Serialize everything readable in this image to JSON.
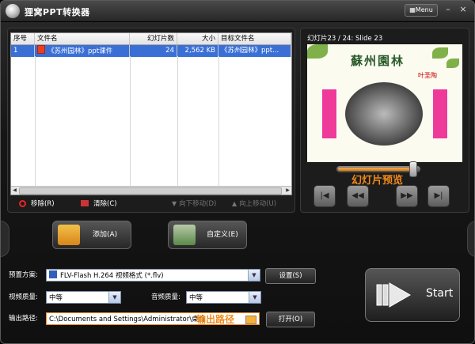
{
  "app": {
    "title": "狸窝PPT转换器",
    "menu_label": "Menu",
    "minimize": "–",
    "close": "×"
  },
  "filelist": {
    "columns": [
      "序号",
      "文件名",
      "幻灯片数",
      "大小",
      "目标文件名"
    ],
    "rows": [
      {
        "index": "1",
        "name": "《苏州园林》ppt课件",
        "slides": "24",
        "size": "2,562 KB",
        "target": "《苏州园林》ppt..."
      }
    ]
  },
  "toolbar": {
    "remove": "移除(R)",
    "clear": "清除(C)",
    "move_down": "向下移动(D)",
    "move_up": "向上移动(U)"
  },
  "preview": {
    "caption": "幻灯片23 / 24: Slide 23",
    "slide_title": "蘇州園林",
    "slide_author": "叶圣陶",
    "label": "幻灯片预览",
    "progress": 0.9
  },
  "actions": {
    "add": "添加(A)",
    "customize": "自定义(E)"
  },
  "form": {
    "preset_label": "预置方案:",
    "preset_value": "FLV-Flash H.264 视频格式 (*.flv)",
    "settings": "设置(S)",
    "video_quality_label": "视频质量:",
    "video_quality_value": "中等",
    "audio_quality_label": "音频质量:",
    "audio_quality_value": "中等",
    "output_label": "输出路径:",
    "output_value": "C:\\Documents and Settings\\Administrator\\桌面",
    "output_hint": "输出路径",
    "open": "打开(O)"
  },
  "start": {
    "label": "Start"
  },
  "colors": {
    "accent_orange": "#f08a1a",
    "selection_blue": "#3a70d6",
    "banner_pink": "#ee3b9a"
  }
}
